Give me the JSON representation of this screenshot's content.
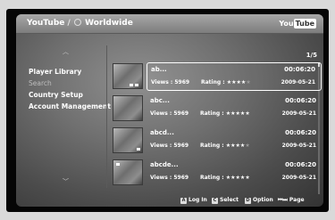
{
  "header": {
    "breadcrumb_app": "YouTube",
    "breadcrumb_sep": " / ",
    "breadcrumb_location": "Worldwide",
    "logo_you": "You",
    "logo_tube": "Tube"
  },
  "sidebar": {
    "items": [
      {
        "label": "Player Library",
        "active": true
      },
      {
        "label": "Search",
        "active": false
      },
      {
        "label": "Country Setup",
        "active": true
      },
      {
        "label": "Account Management",
        "active": true
      }
    ],
    "up_arrow": "︿",
    "down_arrow": "﹀"
  },
  "pagination": {
    "text": "1/5"
  },
  "videos": [
    {
      "title": "ab...",
      "duration": "00:06:20",
      "views": "Views : 5969",
      "rating_label": "Rating :",
      "stars": 4,
      "date": "2009-05-21",
      "selected": true
    },
    {
      "title": "abc...",
      "duration": "00:06:20",
      "views": "Views : 5969",
      "rating_label": "Rating :",
      "stars": 5,
      "date": "2009-05-21",
      "selected": false
    },
    {
      "title": "abcd...",
      "duration": "00:06:20",
      "views": "Views : 5969",
      "rating_label": "Rating :",
      "stars": 4,
      "date": "2009-05-21",
      "selected": false
    },
    {
      "title": "abcde...",
      "duration": "00:06:20",
      "views": "Views : 5969",
      "rating_label": "Rating :",
      "stars": 5,
      "date": "2009-05-21",
      "selected": false
    }
  ],
  "footer": {
    "login": {
      "key": "A",
      "label": "Log In"
    },
    "select": {
      "key": "C",
      "label": "Select"
    },
    "option": {
      "key": "D",
      "label": "Option"
    },
    "page": {
      "key": "⏮⏭",
      "label": "Page"
    }
  },
  "colors": {
    "panel": "#707070",
    "header": "#999999",
    "text": "#ffffff",
    "star_off": "#9a9a9a"
  }
}
